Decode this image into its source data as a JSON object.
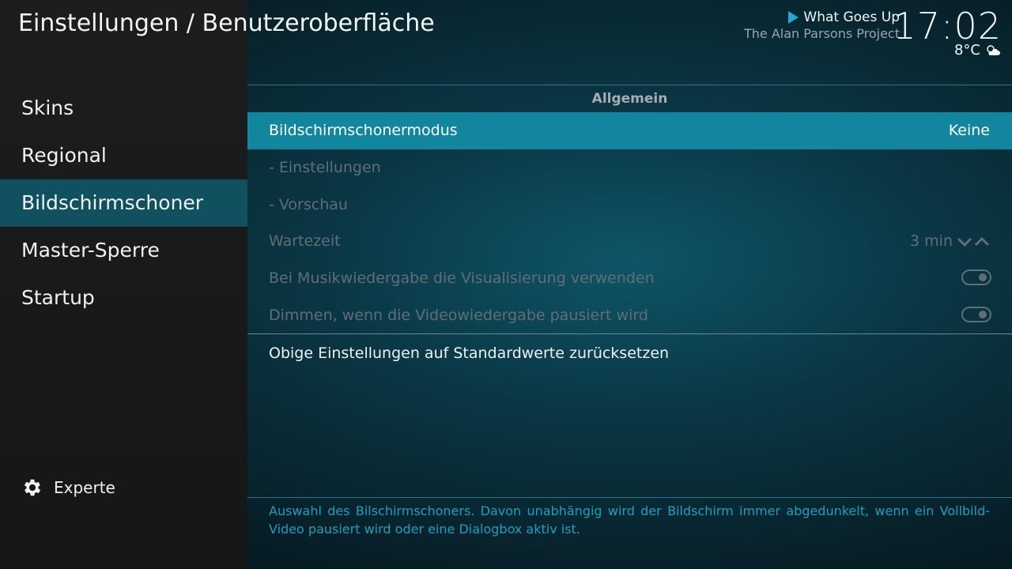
{
  "header": {
    "title": "Einstellungen / Benutzeroberfläche"
  },
  "now_playing": {
    "icon": "play-icon",
    "title": "What Goes Up",
    "artist": "The Alan Parsons Project"
  },
  "clock": {
    "time": "17:02"
  },
  "weather": {
    "temperature": "8°C",
    "icon": "partly-cloudy-icon"
  },
  "sidebar": {
    "items": [
      {
        "label": "Skins"
      },
      {
        "label": "Regional"
      },
      {
        "label": "Bildschirmschoner"
      },
      {
        "label": "Master-Sperre"
      },
      {
        "label": "Startup"
      }
    ],
    "active_label": "Bildschirmschoner",
    "expert": {
      "icon": "gear-icon",
      "label": "Experte"
    }
  },
  "settings": {
    "group_title": "Allgemein",
    "rows": [
      {
        "label": "Bildschirmschonermodus",
        "value": "Keine",
        "state": "selected"
      },
      {
        "label": "- Einstellungen",
        "value": "",
        "state": "disabled"
      },
      {
        "label": "- Vorschau",
        "value": "",
        "state": "disabled"
      },
      {
        "label": "Wartezeit",
        "value": "3 min",
        "state": "disabled",
        "control": "spinner"
      },
      {
        "label": "Bei Musikwiedergabe die Visualisierung verwenden",
        "value": "",
        "state": "disabled",
        "control": "toggle",
        "on": true
      },
      {
        "label": "Dimmen, wenn die Videowiedergabe pausiert wird",
        "value": "",
        "state": "disabled",
        "control": "toggle",
        "on": true
      }
    ],
    "reset_label": "Obige Einstellungen auf Standardwerte zurücksetzen"
  },
  "description": "Auswahl des Bilschirmschoners. Davon unabhängig wird der Bildschirm immer abgedunkelt, wenn ein Vollbild-Video pausiert wird oder eine Dialogbox aktiv ist.",
  "colors": {
    "accent": "#12869f",
    "sidebar_active": "#10505f",
    "description_text": "#1f9ec0"
  }
}
